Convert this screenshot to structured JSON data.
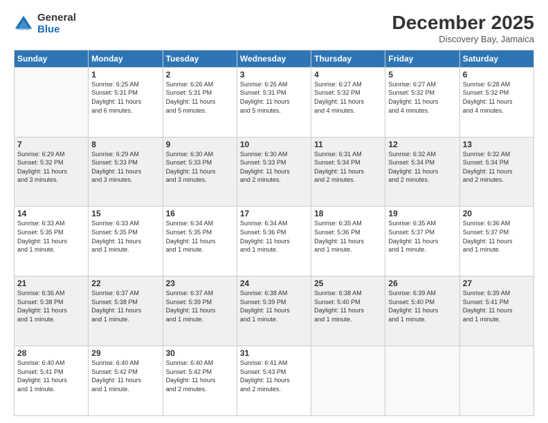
{
  "header": {
    "logo_general": "General",
    "logo_blue": "Blue",
    "month_title": "December 2025",
    "location": "Discovery Bay, Jamaica"
  },
  "days_of_week": [
    "Sunday",
    "Monday",
    "Tuesday",
    "Wednesday",
    "Thursday",
    "Friday",
    "Saturday"
  ],
  "weeks": [
    [
      {
        "num": "",
        "info": ""
      },
      {
        "num": "1",
        "info": "Sunrise: 6:25 AM\nSunset: 5:31 PM\nDaylight: 11 hours\nand 6 minutes."
      },
      {
        "num": "2",
        "info": "Sunrise: 6:26 AM\nSunset: 5:31 PM\nDaylight: 11 hours\nand 5 minutes."
      },
      {
        "num": "3",
        "info": "Sunrise: 6:26 AM\nSunset: 5:31 PM\nDaylight: 11 hours\nand 5 minutes."
      },
      {
        "num": "4",
        "info": "Sunrise: 6:27 AM\nSunset: 5:32 PM\nDaylight: 11 hours\nand 4 minutes."
      },
      {
        "num": "5",
        "info": "Sunrise: 6:27 AM\nSunset: 5:32 PM\nDaylight: 11 hours\nand 4 minutes."
      },
      {
        "num": "6",
        "info": "Sunrise: 6:28 AM\nSunset: 5:32 PM\nDaylight: 11 hours\nand 4 minutes."
      }
    ],
    [
      {
        "num": "7",
        "info": "Sunrise: 6:29 AM\nSunset: 5:32 PM\nDaylight: 11 hours\nand 3 minutes."
      },
      {
        "num": "8",
        "info": "Sunrise: 6:29 AM\nSunset: 5:33 PM\nDaylight: 11 hours\nand 3 minutes."
      },
      {
        "num": "9",
        "info": "Sunrise: 6:30 AM\nSunset: 5:33 PM\nDaylight: 11 hours\nand 3 minutes."
      },
      {
        "num": "10",
        "info": "Sunrise: 6:30 AM\nSunset: 5:33 PM\nDaylight: 11 hours\nand 2 minutes."
      },
      {
        "num": "11",
        "info": "Sunrise: 6:31 AM\nSunset: 5:34 PM\nDaylight: 11 hours\nand 2 minutes."
      },
      {
        "num": "12",
        "info": "Sunrise: 6:32 AM\nSunset: 5:34 PM\nDaylight: 11 hours\nand 2 minutes."
      },
      {
        "num": "13",
        "info": "Sunrise: 6:32 AM\nSunset: 5:34 PM\nDaylight: 11 hours\nand 2 minutes."
      }
    ],
    [
      {
        "num": "14",
        "info": "Sunrise: 6:33 AM\nSunset: 5:35 PM\nDaylight: 11 hours\nand 1 minute."
      },
      {
        "num": "15",
        "info": "Sunrise: 6:33 AM\nSunset: 5:35 PM\nDaylight: 11 hours\nand 1 minute."
      },
      {
        "num": "16",
        "info": "Sunrise: 6:34 AM\nSunset: 5:35 PM\nDaylight: 11 hours\nand 1 minute."
      },
      {
        "num": "17",
        "info": "Sunrise: 6:34 AM\nSunset: 5:36 PM\nDaylight: 11 hours\nand 1 minute."
      },
      {
        "num": "18",
        "info": "Sunrise: 6:35 AM\nSunset: 5:36 PM\nDaylight: 11 hours\nand 1 minute."
      },
      {
        "num": "19",
        "info": "Sunrise: 6:35 AM\nSunset: 5:37 PM\nDaylight: 11 hours\nand 1 minute."
      },
      {
        "num": "20",
        "info": "Sunrise: 6:36 AM\nSunset: 5:37 PM\nDaylight: 11 hours\nand 1 minute."
      }
    ],
    [
      {
        "num": "21",
        "info": "Sunrise: 6:36 AM\nSunset: 5:38 PM\nDaylight: 11 hours\nand 1 minute."
      },
      {
        "num": "22",
        "info": "Sunrise: 6:37 AM\nSunset: 5:38 PM\nDaylight: 11 hours\nand 1 minute."
      },
      {
        "num": "23",
        "info": "Sunrise: 6:37 AM\nSunset: 5:39 PM\nDaylight: 11 hours\nand 1 minute."
      },
      {
        "num": "24",
        "info": "Sunrise: 6:38 AM\nSunset: 5:39 PM\nDaylight: 11 hours\nand 1 minute."
      },
      {
        "num": "25",
        "info": "Sunrise: 6:38 AM\nSunset: 5:40 PM\nDaylight: 11 hours\nand 1 minute."
      },
      {
        "num": "26",
        "info": "Sunrise: 6:39 AM\nSunset: 5:40 PM\nDaylight: 11 hours\nand 1 minute."
      },
      {
        "num": "27",
        "info": "Sunrise: 6:39 AM\nSunset: 5:41 PM\nDaylight: 11 hours\nand 1 minute."
      }
    ],
    [
      {
        "num": "28",
        "info": "Sunrise: 6:40 AM\nSunset: 5:41 PM\nDaylight: 11 hours\nand 1 minute."
      },
      {
        "num": "29",
        "info": "Sunrise: 6:40 AM\nSunset: 5:42 PM\nDaylight: 11 hours\nand 1 minute."
      },
      {
        "num": "30",
        "info": "Sunrise: 6:40 AM\nSunset: 5:42 PM\nDaylight: 11 hours\nand 2 minutes."
      },
      {
        "num": "31",
        "info": "Sunrise: 6:41 AM\nSunset: 5:43 PM\nDaylight: 11 hours\nand 2 minutes."
      },
      {
        "num": "",
        "info": ""
      },
      {
        "num": "",
        "info": ""
      },
      {
        "num": "",
        "info": ""
      }
    ]
  ]
}
